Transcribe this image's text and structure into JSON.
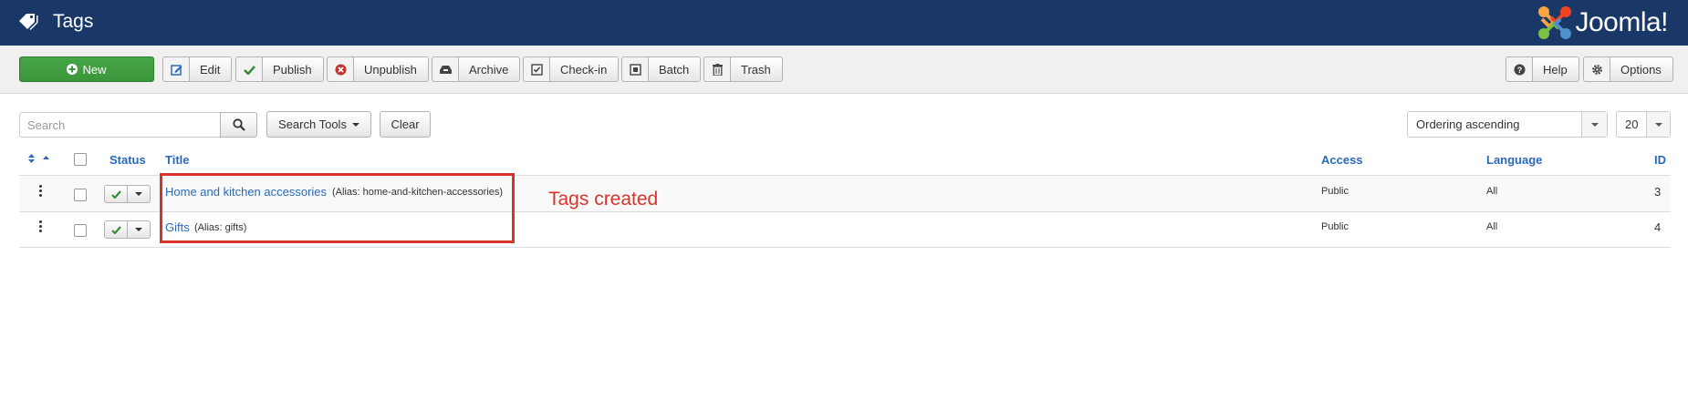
{
  "header": {
    "title": "Tags",
    "brand": "Joomla!",
    "brand_name": "Joomla!"
  },
  "toolbar": {
    "new_label": "New",
    "edit_label": "Edit",
    "publish_label": "Publish",
    "unpublish_label": "Unpublish",
    "archive_label": "Archive",
    "checkin_label": "Check-in",
    "batch_label": "Batch",
    "trash_label": "Trash",
    "help_label": "Help",
    "options_label": "Options"
  },
  "filters": {
    "search_placeholder": "Search",
    "search_value": "",
    "search_tools_label": "Search Tools",
    "clear_label": "Clear",
    "ordering_value": "Ordering ascending",
    "limit_value": "20"
  },
  "table": {
    "columns": {
      "status": "Status",
      "title": "Title",
      "access": "Access",
      "language": "Language",
      "id": "ID"
    },
    "rows": [
      {
        "title": "Home and kitchen accessories",
        "alias": "(Alias: home-and-kitchen-accessories)",
        "access": "Public",
        "language": "All",
        "id": "3"
      },
      {
        "title": "Gifts",
        "alias": "(Alias: gifts)",
        "access": "Public",
        "language": "All",
        "id": "4"
      }
    ]
  },
  "annotation": {
    "text": "Tags created",
    "color": "#d9342b"
  },
  "colors": {
    "header_bg": "#1a3867",
    "new_button": "#46a546",
    "link": "#2a69b8",
    "published_check": "#3b8a3b"
  },
  "icons": {
    "header": "tag-icon",
    "brand": "joomla-logo-icon",
    "toolbar": [
      "plus-circle-icon",
      "edit-icon",
      "check-icon",
      "times-circle-icon",
      "archive-icon",
      "checkbox-icon",
      "batch-icon",
      "trash-icon",
      "question-circle-icon",
      "gear-icon"
    ]
  }
}
